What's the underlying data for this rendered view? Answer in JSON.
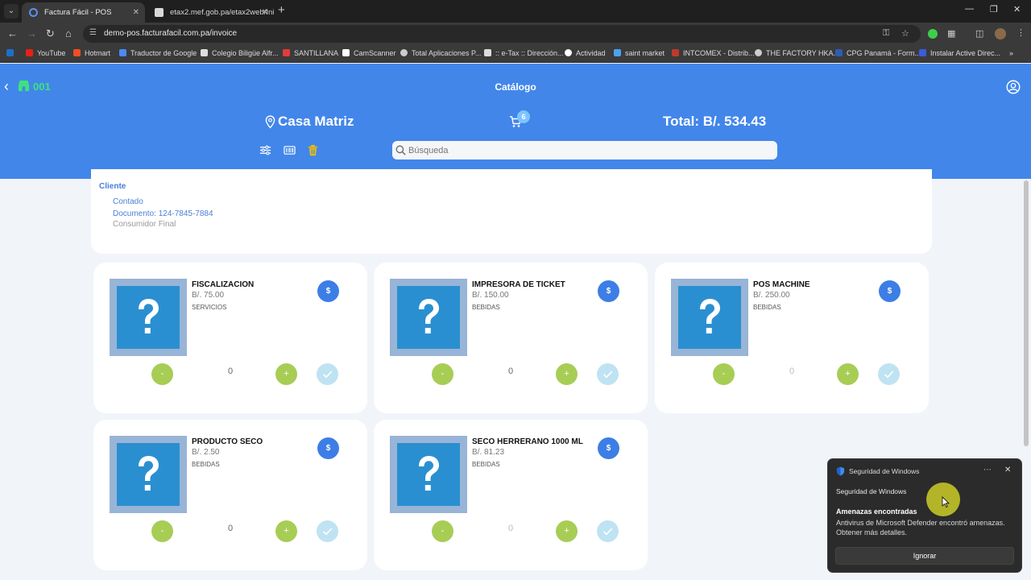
{
  "browser": {
    "tabs": [
      {
        "title": "Factura Fácil - POS",
        "active": true
      },
      {
        "title": "etax2.mef.gob.pa/etax2web/Ini",
        "active": false
      }
    ],
    "url": "demo-pos.facturafacil.com.pa/invoice",
    "bookmarks": [
      {
        "label": "YouTube",
        "color": "#e62117"
      },
      {
        "label": "Hotmart",
        "color": "#f04e23"
      },
      {
        "label": "Traductor de Google",
        "color": "#4a8af4"
      },
      {
        "label": "Colegio Biligüe Alfr...",
        "color": "#dddddd"
      },
      {
        "label": "SANTILLANA",
        "color": "#e33b3b"
      },
      {
        "label": "CamScanner",
        "color": "#ffffff"
      },
      {
        "label": "Total Aplicaciones P...",
        "color": "#cccccc"
      },
      {
        "label": ":: e-Tax :: Dirección...",
        "color": "#dddddd"
      },
      {
        "label": "Actividad",
        "color": "#ffffff"
      },
      {
        "label": "saint market",
        "color": "#4aa3f0"
      },
      {
        "label": "INTCOMEX - Distrib...",
        "color": "#c0392b"
      },
      {
        "label": "THE FACTORY HKA...",
        "color": "#cccccc"
      },
      {
        "label": "CPG Panamá - Form...",
        "color": "#2e5db0"
      },
      {
        "label": "Instalar Active Direc...",
        "color": "#3b5bdb"
      }
    ]
  },
  "header": {
    "store_code": "001",
    "title": "Catálogo",
    "branch": "Casa Matriz",
    "cart_count": "6",
    "total": "Total: B/. 534.43",
    "search_placeholder": "Búsqueda"
  },
  "client": {
    "title": "Cliente",
    "type": "Contado",
    "document": "Documento: 124-7845-7884",
    "name": "Consumidor Final"
  },
  "products": [
    {
      "name": "FISCALIZACION",
      "price": "B/. 75.00",
      "category": "SERVICIOS",
      "qty": "0",
      "qty_faded": false
    },
    {
      "name": "IMPRESORA DE TICKET",
      "price": "B/. 150.00",
      "category": "BEBIDAS",
      "qty": "0",
      "qty_faded": false
    },
    {
      "name": "POS MACHINE",
      "price": "B/. 250.00",
      "category": "BEBIDAS",
      "qty": "0",
      "qty_faded": true
    },
    {
      "name": "PRODUCTO SECO",
      "price": "B/. 2.50",
      "category": "BEBIDAS",
      "qty": "0",
      "qty_faded": false
    },
    {
      "name": "SECO HERRERANO 1000 ML",
      "price": "B/. 81.23",
      "category": "BEBIDAS",
      "qty": "0",
      "qty_faded": true
    }
  ],
  "product_labels": {
    "dollar": "$",
    "minus": "-",
    "plus": "+"
  },
  "toast": {
    "app": "Seguridad de Windows",
    "source": "Seguridad de Windows",
    "heading": "Amenazas encontradas",
    "body": "Antivirus de Microsoft Defender encontró amenazas. Obtener más detalles.",
    "button": "Ignorar"
  },
  "colors": {
    "header_bg": "#4286ea",
    "store_code": "#3ee37a",
    "qty_button": "#a7cd55",
    "price_button": "#3d7ee6",
    "check_button": "#bfe3f2",
    "trash_icon": "#f2c200"
  }
}
